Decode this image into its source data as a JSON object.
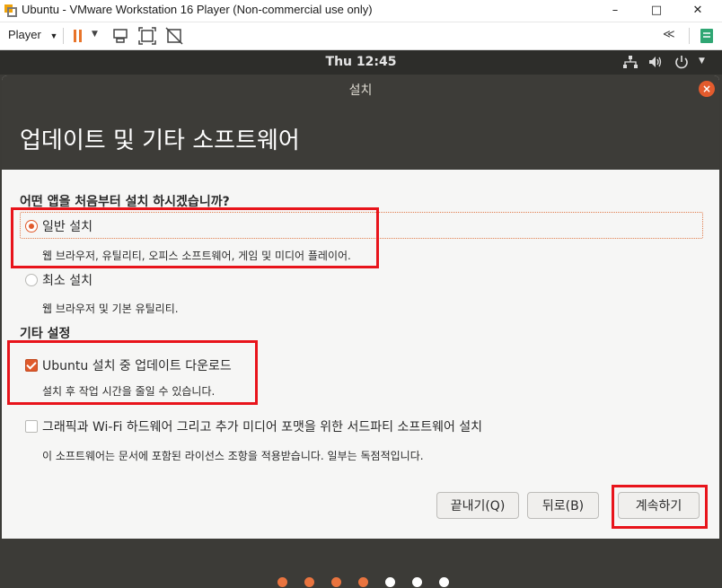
{
  "window": {
    "title": "Ubuntu - VMware Workstation 16 Player (Non-commercial use only)",
    "minimize": "–",
    "maximize": "□",
    "close": "✕"
  },
  "toolbar": {
    "player_menu": "Player",
    "icons": [
      "pause-icon",
      "send-ctrl-alt-del-icon",
      "fit-guest-icon",
      "unity-icon",
      "collapse-icon",
      "notes-icon"
    ]
  },
  "panel": {
    "clock": "Thu 12:45"
  },
  "installer": {
    "window_title": "설치",
    "page_title": "업데이트 및 기타 소프트웨어",
    "question": "어떤 앱을 처음부터 설치 하시겠습니까?",
    "normal_install": {
      "label": "일반 설치",
      "desc": "웹 브라우저, 유틸리티, 오피스  소프트웨어, 게임 및 미디어 플레이어.",
      "selected": true
    },
    "minimal_install": {
      "label": "최소 설치",
      "desc": "웹 브라우저 및 기본 유틸리티.",
      "selected": false
    },
    "other_options_title": "기타 설정",
    "download_updates": {
      "label": "Ubuntu 설치 중 업데이트 다운로드",
      "desc": "설치 후 작업 시간을 줄일 수 있습니다.",
      "checked": true
    },
    "third_party": {
      "label": "그래픽과 Wi-Fi 하드웨어 그리고 추가 미디어 포맷을 위한 서드파티 소프트웨어 설치",
      "desc": "이 소프트웨어는 문서에 포함된 라이선스 조항을 적용받습니다. 일부는 독점적입니다.",
      "checked": false
    },
    "buttons": {
      "quit": "끝내기(Q)",
      "back": "뒤로(B)",
      "continue": "계속하기"
    }
  },
  "progress": {
    "total_steps": 7,
    "completed_steps": 4
  },
  "colors": {
    "accent": "#e05a2b",
    "highlight": "#e8141b",
    "header": "#3d3c38",
    "dot_done": "#e9743f",
    "dot_todo": "#ffffff"
  }
}
